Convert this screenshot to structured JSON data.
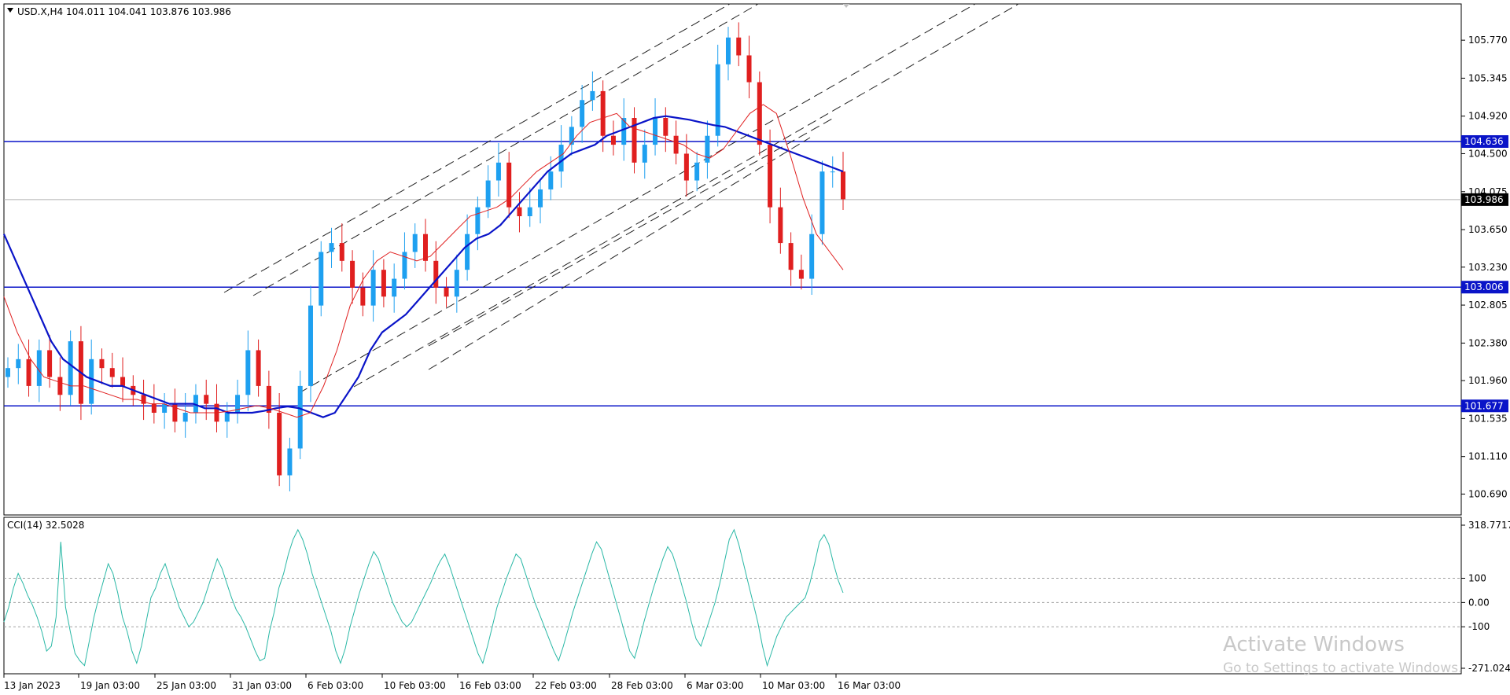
{
  "window": {
    "symbol_header": "USD.X,H4  104.011 104.041 103.876 103.986",
    "indicator_header": "CCI(14) 32.5028"
  },
  "watermark": {
    "line1": "Activate Windows",
    "line2": "Go to Settings to activate Windows."
  },
  "colors": {
    "bull_candle": "#1ea0f0",
    "bear_candle": "#e01f1f",
    "ma_slow": "#0a14c8",
    "ma_fast": "#e01f1f",
    "hline": "#0a14c8",
    "cci_line": "#2ab8a6",
    "channel": "#222222"
  },
  "chart_data": [
    {
      "type": "line",
      "title": "USD.X,H4",
      "ylim": [
        100.5,
        106.0
      ],
      "y_ticks": [
        "105.770",
        "105.345",
        "104.920",
        "104.500",
        "104.075",
        "103.650",
        "103.230",
        "102.805",
        "102.380",
        "101.960",
        "101.535",
        "101.110",
        "100.690"
      ],
      "x_ticks": [
        "13 Jan 2023",
        "19 Jan 03:00",
        "25 Jan 03:00",
        "31 Jan 03:00",
        "6 Feb 03:00",
        "10 Feb 03:00",
        "16 Feb 03:00",
        "22 Feb 03:00",
        "28 Feb 03:00",
        "6 Mar 03:00",
        "10 Mar 03:00",
        "16 Mar 03:00"
      ],
      "horizontal_levels": [
        "104.636",
        "103.006",
        "101.677"
      ],
      "current_price": "103.986",
      "series": [
        {
          "values": [
            102.1,
            102.2,
            101.9,
            102.3,
            102.0,
            101.8,
            102.4,
            101.7,
            102.2,
            102.1,
            102.0,
            101.9,
            101.8,
            101.7,
            101.6,
            101.7,
            101.5,
            101.6,
            101.8,
            101.7,
            101.5,
            101.6,
            101.8,
            102.3,
            101.9,
            101.6,
            100.9,
            101.2,
            101.9,
            102.8,
            103.4,
            103.5,
            103.3,
            103.0,
            102.8,
            103.2,
            102.9,
            103.1,
            103.4,
            103.6,
            103.3,
            103.0,
            102.9,
            103.2,
            103.6,
            103.9,
            104.2,
            104.4,
            103.9,
            103.8,
            103.9,
            104.1,
            104.3,
            104.6,
            104.8,
            105.1,
            105.2,
            104.7,
            104.6,
            104.9,
            104.4,
            104.6,
            104.9,
            104.7,
            104.5,
            104.2,
            104.4,
            104.7,
            105.5,
            105.8,
            105.6,
            105.3,
            104.6,
            103.9,
            103.5,
            103.2,
            103.1,
            103.6,
            104.3,
            104.3,
            103.99
          ],
          "marker": "candlestick close"
        },
        {
          "values": [
            103.6,
            103.3,
            103.0,
            102.7,
            102.4,
            102.2,
            102.1,
            102.0,
            101.95,
            101.9,
            101.9,
            101.85,
            101.8,
            101.75,
            101.7,
            101.7,
            101.7,
            101.65,
            101.65,
            101.6,
            101.6,
            101.6,
            101.62,
            101.65,
            101.67,
            101.65,
            101.6,
            101.55,
            101.6,
            101.8,
            102.0,
            102.3,
            102.5,
            102.6,
            102.7,
            102.85,
            103.0,
            103.15,
            103.3,
            103.45,
            103.55,
            103.6,
            103.7,
            103.85,
            104.0,
            104.15,
            104.3,
            104.4,
            104.5,
            104.55,
            104.6,
            104.7,
            104.75,
            104.8,
            104.85,
            104.9,
            104.92,
            104.9,
            104.88,
            104.85,
            104.82,
            104.8,
            104.75,
            104.7,
            104.65,
            104.6,
            104.55,
            104.5,
            104.45,
            104.4,
            104.35,
            104.3
          ],
          "name": "",
          "marker": "slow moving average"
        },
        {
          "values": [
            102.9,
            102.5,
            102.2,
            102.0,
            101.95,
            101.9,
            101.9,
            101.85,
            101.8,
            101.75,
            101.75,
            101.7,
            101.7,
            101.65,
            101.6,
            101.6,
            101.6,
            101.62,
            101.65,
            101.68,
            101.65,
            101.6,
            101.55,
            101.6,
            101.9,
            102.3,
            102.8,
            103.1,
            103.3,
            103.4,
            103.35,
            103.3,
            103.35,
            103.5,
            103.65,
            103.8,
            103.85,
            103.9,
            104.0,
            104.15,
            104.3,
            104.4,
            104.5,
            104.7,
            104.85,
            104.9,
            104.95,
            104.8,
            104.75,
            104.7,
            104.65,
            104.6,
            104.5,
            104.45,
            104.55,
            104.75,
            104.95,
            105.05,
            104.95,
            104.5,
            104.0,
            103.6,
            103.4,
            103.2
          ],
          "name": "",
          "marker": "fast moving average"
        }
      ]
    },
    {
      "type": "line",
      "title": "CCI(14) 32.5028",
      "ylim": [
        -271.0242,
        318.7717
      ],
      "y_ticks": [
        "318.7717",
        "100",
        "0.00",
        "-100",
        "-271.0242"
      ],
      "levels": [
        100,
        0,
        -100
      ],
      "series": [
        {
          "values": [
            -80,
            -20,
            60,
            120,
            80,
            30,
            -10,
            -60,
            -120,
            -200,
            -180,
            -60,
            250,
            -20,
            -120,
            -210,
            -240,
            -260,
            -160,
            -60,
            20,
            90,
            160,
            120,
            40,
            -60,
            -120,
            -200,
            -250,
            -180,
            -80,
            20,
            60,
            120,
            160,
            100,
            40,
            -20,
            -60,
            -100,
            -80,
            -40,
            0,
            60,
            120,
            180,
            140,
            80,
            20,
            -30,
            -60,
            -100,
            -150,
            -200,
            -240,
            -230,
            -120,
            -40,
            60,
            120,
            200,
            260,
            300,
            260,
            200,
            120,
            60,
            0,
            -60,
            -120,
            -200,
            -250,
            -190,
            -100,
            -30,
            40,
            100,
            160,
            210,
            180,
            120,
            60,
            0,
            -40,
            -80,
            -100,
            -80,
            -40,
            0,
            40,
            80,
            130,
            170,
            200,
            150,
            90,
            30,
            -30,
            -90,
            -150,
            -210,
            -250,
            -180,
            -100,
            -20,
            40,
            100,
            150,
            200,
            180,
            120,
            60,
            0,
            -50,
            -100,
            -150,
            -200,
            -240,
            -180,
            -110,
            -40,
            20,
            80,
            140,
            200,
            250,
            220,
            150,
            80,
            10,
            -60,
            -130,
            -200,
            -230,
            -160,
            -80,
            -10,
            60,
            120,
            180,
            230,
            200,
            140,
            70,
            0,
            -80,
            -150,
            -180,
            -120,
            -60,
            0,
            80,
            170,
            260,
            300,
            240,
            160,
            80,
            0,
            -80,
            -180,
            -260,
            -200,
            -140,
            -100,
            -60,
            -40,
            -20,
            0,
            20,
            80,
            160,
            250,
            280,
            240,
            160,
            90,
            40
          ],
          "marker": "line"
        }
      ]
    }
  ]
}
